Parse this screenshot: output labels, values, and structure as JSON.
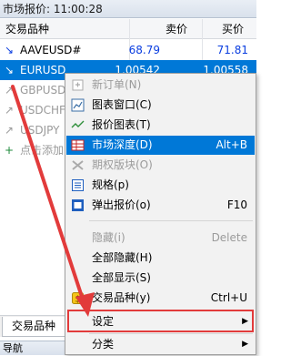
{
  "window": {
    "title": "市场报价: 11:00:28"
  },
  "columns": {
    "symbol": "交易品种",
    "bid": "卖价",
    "ask": "买价"
  },
  "rows": [
    {
      "symbol": "AAVEUSD#",
      "bid": "68.79",
      "ask": "71.81",
      "arrow": "↘"
    },
    {
      "symbol": "EURUSD",
      "bid": "1.00542",
      "ask": "1.00558",
      "arrow": "↘"
    },
    {
      "symbol": "GBPUSD",
      "arrow": "↗"
    },
    {
      "symbol": "USDCHF",
      "arrow": "↗"
    },
    {
      "symbol": "USDJPY",
      "arrow": "↗"
    },
    {
      "symbol": "点击添加",
      "arrow": "+"
    }
  ],
  "tabs": {
    "symbols": "交易品种"
  },
  "navigator": {
    "title": "导航"
  },
  "context_menu": {
    "items": [
      {
        "label": "新订单(N)",
        "shortcut": ""
      },
      {
        "label": "图表窗口(C)",
        "shortcut": ""
      },
      {
        "label": "报价图表(T)",
        "shortcut": ""
      },
      {
        "label": "市场深度(D)",
        "shortcut": "Alt+B"
      },
      {
        "label": "期权版块(O)",
        "shortcut": ""
      },
      {
        "label": "规格(p)",
        "shortcut": ""
      },
      {
        "label": "弹出报价(o)",
        "shortcut": "F10"
      },
      {
        "label": "隐藏(i)",
        "shortcut": "Delete"
      },
      {
        "label": "全部隐藏(H)",
        "shortcut": ""
      },
      {
        "label": "全部显示(S)",
        "shortcut": ""
      },
      {
        "label": "交易品种(y)",
        "shortcut": "Ctrl+U"
      },
      {
        "label": "设定",
        "shortcut": ""
      },
      {
        "label": "分类",
        "shortcut": ""
      }
    ]
  },
  "colors": {
    "selection": "#0078d7",
    "annotation": "#e23b3b"
  }
}
